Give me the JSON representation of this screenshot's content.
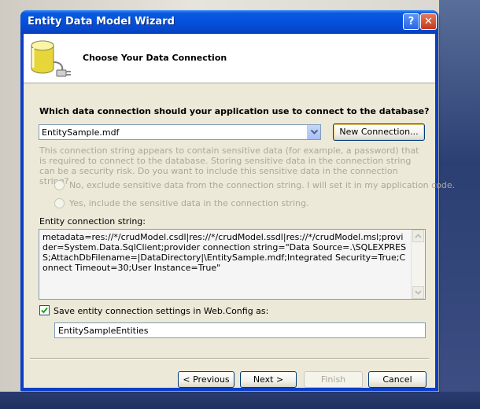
{
  "window": {
    "title": "Entity Data Model Wizard",
    "help_glyph": "?",
    "close_glyph": "✕"
  },
  "header": {
    "title": "Choose Your Data Connection",
    "icon": "database-plug-icon"
  },
  "connection": {
    "question": "Which data connection should your application use to connect to the database?",
    "selected": "EntitySample.mdf",
    "new_connection_label": "New Connection..."
  },
  "sensitive": {
    "description": "This connection string appears to contain sensitive data (for example, a password) that is required to connect to the database. Storing sensitive data in the connection string can be a security risk. Do you want to include this sensitive data in the connection string?",
    "option_no": "No, exclude sensitive data from the connection string. I will set it in my application code.",
    "option_yes": "Yes, include the sensitive data in the connection string."
  },
  "entity_connection": {
    "label": "Entity connection string:",
    "value": "metadata=res://*/crudModel.csdl|res://*/crudModel.ssdl|res://*/crudModel.msl;provider=System.Data.SqlClient;provider connection string=\"Data Source=.\\SQLEXPRESS;AttachDbFilename=|DataDirectory|\\EntitySample.mdf;Integrated Security=True;Connect Timeout=30;User Instance=True\""
  },
  "save_settings": {
    "checked": true,
    "label": "Save entity connection settings in Web.Config as:",
    "value": "EntitySampleEntities"
  },
  "footer": {
    "previous_label": "< Previous",
    "next_label": "Next >",
    "finish_label": "Finish",
    "cancel_label": "Cancel"
  }
}
